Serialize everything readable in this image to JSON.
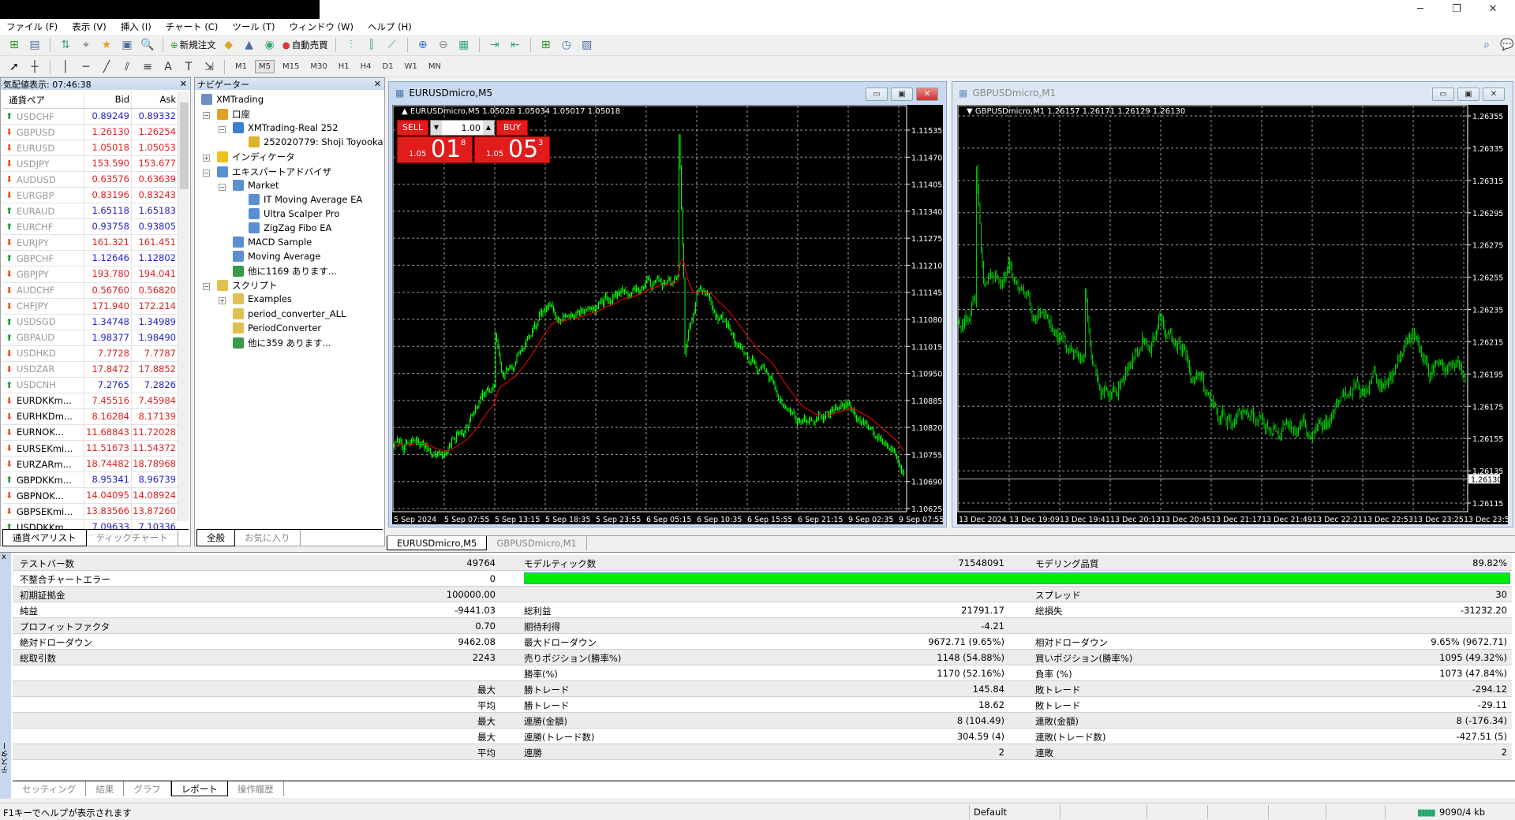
{
  "window": {
    "minimize": "─",
    "restore": "❐",
    "close": "✕"
  },
  "menu": [
    "ファイル (F)",
    "表示 (V)",
    "挿入 (I)",
    "チャート (C)",
    "ツール (T)",
    "ウィンドウ (W)",
    "ヘルプ (H)"
  ],
  "toolbar1": {
    "new_order": "新規注文",
    "auto_trading": "自動売買"
  },
  "toolbar2": {
    "timeframes": [
      "M1",
      "M5",
      "M15",
      "M30",
      "H1",
      "H4",
      "D1",
      "W1",
      "MN"
    ],
    "active_timeframe": "M5"
  },
  "market_watch": {
    "title": "気配値表示: 07:46:38",
    "columns": [
      "通貨ペア",
      "Bid",
      "Ask"
    ],
    "rows": [
      {
        "symbol": "USDCHF",
        "bid": "0.89249",
        "ask": "0.89332",
        "dir": "up",
        "dim": true
      },
      {
        "symbol": "GBPUSD",
        "bid": "1.26130",
        "ask": "1.26254",
        "dir": "down",
        "dim": true
      },
      {
        "symbol": "EURUSD",
        "bid": "1.05018",
        "ask": "1.05053",
        "dir": "down",
        "dim": true
      },
      {
        "symbol": "USDJPY",
        "bid": "153.590",
        "ask": "153.677",
        "dir": "down",
        "dim": true
      },
      {
        "symbol": "AUDUSD",
        "bid": "0.63576",
        "ask": "0.63639",
        "dir": "down",
        "dim": true
      },
      {
        "symbol": "EURGBP",
        "bid": "0.83196",
        "ask": "0.83243",
        "dir": "down",
        "dim": true
      },
      {
        "symbol": "EURAUD",
        "bid": "1.65118",
        "ask": "1.65183",
        "dir": "up",
        "dim": true
      },
      {
        "symbol": "EURCHF",
        "bid": "0.93758",
        "ask": "0.93805",
        "dir": "up",
        "dim": true
      },
      {
        "symbol": "EURJPY",
        "bid": "161.321",
        "ask": "161.451",
        "dir": "down",
        "dim": true
      },
      {
        "symbol": "GBPCHF",
        "bid": "1.12646",
        "ask": "1.12802",
        "dir": "up",
        "dim": true
      },
      {
        "symbol": "GBPJPY",
        "bid": "193.780",
        "ask": "194.041",
        "dir": "down",
        "dim": true
      },
      {
        "symbol": "AUDCHF",
        "bid": "0.56760",
        "ask": "0.56820",
        "dir": "down",
        "dim": true
      },
      {
        "symbol": "CHFJPY",
        "bid": "171.940",
        "ask": "172.214",
        "dir": "down",
        "dim": true
      },
      {
        "symbol": "USDSGD",
        "bid": "1.34748",
        "ask": "1.34989",
        "dir": "up",
        "dim": true
      },
      {
        "symbol": "GBPAUD",
        "bid": "1.98377",
        "ask": "1.98490",
        "dir": "up",
        "dim": true
      },
      {
        "symbol": "USDHKD",
        "bid": "7.7728",
        "ask": "7.7787",
        "dir": "down",
        "dim": true
      },
      {
        "symbol": "USDZAR",
        "bid": "17.8472",
        "ask": "17.8852",
        "dir": "down",
        "dim": true
      },
      {
        "symbol": "USDCNH",
        "bid": "7.2765",
        "ask": "7.2826",
        "dir": "up",
        "dim": true
      },
      {
        "symbol": "EURDKKm...",
        "bid": "7.45516",
        "ask": "7.45984",
        "dir": "down",
        "dim": false
      },
      {
        "symbol": "EURHKDm...",
        "bid": "8.16284",
        "ask": "8.17139",
        "dir": "down",
        "dim": false
      },
      {
        "symbol": "EURNOK...",
        "bid": "11.68843",
        "ask": "11.72028",
        "dir": "down",
        "dim": false
      },
      {
        "symbol": "EURSEKmi...",
        "bid": "11.51673",
        "ask": "11.54372",
        "dir": "down",
        "dim": false
      },
      {
        "symbol": "EURZARm...",
        "bid": "18.74482",
        "ask": "18.78968",
        "dir": "down",
        "dim": false
      },
      {
        "symbol": "GBPDKKm...",
        "bid": "8.95341",
        "ask": "8.96739",
        "dir": "up",
        "dim": false
      },
      {
        "symbol": "GBPNOK...",
        "bid": "14.04095",
        "ask": "14.08924",
        "dir": "down",
        "dim": false
      },
      {
        "symbol": "GBPSEKmi...",
        "bid": "13.83566",
        "ask": "13.87260",
        "dir": "down",
        "dim": false
      },
      {
        "symbol": "USDDKKm...",
        "bid": "7.09633",
        "ask": "7.10336",
        "dir": "up",
        "dim": false
      }
    ],
    "tabs": [
      "通貨ペアリスト",
      "ティックチャート"
    ]
  },
  "navigator": {
    "title": "ナビゲーター",
    "items": [
      {
        "label": "XMTrading",
        "level": 0,
        "icon": "terminal-icon"
      },
      {
        "label": "口座",
        "level": 1,
        "icon": "accounts-icon",
        "exp": "-"
      },
      {
        "label": "XMTrading-Real 252",
        "level": 2,
        "icon": "server-icon",
        "exp": "-"
      },
      {
        "label": "252020779: Shoji Toyooka",
        "level": 3,
        "icon": "user-icon"
      },
      {
        "label": "インディケータ",
        "level": 1,
        "icon": "indicator-icon",
        "exp": "+"
      },
      {
        "label": "エキスパートアドバイザ",
        "level": 1,
        "icon": "expert-icon",
        "exp": "-"
      },
      {
        "label": "Market",
        "level": 2,
        "icon": "expert-icon",
        "exp": "-"
      },
      {
        "label": "IT Moving Average EA",
        "level": 3,
        "icon": "expert-icon"
      },
      {
        "label": "Ultra Scalper Pro",
        "level": 3,
        "icon": "expert-icon"
      },
      {
        "label": "ZigZag Fibo EA",
        "level": 3,
        "icon": "expert-icon"
      },
      {
        "label": "MACD Sample",
        "level": 2,
        "icon": "expert-icon"
      },
      {
        "label": "Moving Average",
        "level": 2,
        "icon": "expert-icon"
      },
      {
        "label": "他に1169 あります...",
        "level": 2,
        "icon": "globe-icon"
      },
      {
        "label": "スクリプト",
        "level": 1,
        "icon": "script-icon",
        "exp": "-"
      },
      {
        "label": "Examples",
        "level": 2,
        "icon": "script-icon",
        "exp": "+"
      },
      {
        "label": "period_converter_ALL",
        "level": 2,
        "icon": "script-icon"
      },
      {
        "label": "PeriodConverter",
        "level": 2,
        "icon": "script-icon"
      },
      {
        "label": "他に359 あります...",
        "level": 2,
        "icon": "globe-icon"
      }
    ],
    "tabs": [
      "全般",
      "お気に入り"
    ]
  },
  "charts": [
    {
      "window_title": "EURUSDmicro,M5",
      "info": "EURUSDmicro,M5  1.05028 1.05034 1.05017 1.05018",
      "active": true,
      "one_click": {
        "sell": "SELL",
        "buy": "BUY",
        "lots": "1.00",
        "sell_small": "1.05",
        "sell_big": "01",
        "sell_pip": "8",
        "buy_small": "1.05",
        "buy_big": "05",
        "buy_pip": "3"
      },
      "chart_data": {
        "type": "bar",
        "price_ticks": [
          "1.11535",
          "1.11470",
          "1.11405",
          "1.11340",
          "1.11275",
          "1.11210",
          "1.11145",
          "1.11080",
          "1.11015",
          "1.10950",
          "1.10885",
          "1.10820",
          "1.10755",
          "1.10690",
          "1.10625"
        ],
        "time_ticks": [
          "5 Sep 2024",
          "5 Sep 07:55",
          "5 Sep 13:15",
          "5 Sep 18:35",
          "5 Sep 23:55",
          "6 Sep 05:15",
          "6 Sep 10:35",
          "6 Sep 15:55",
          "6 Sep 21:15",
          "9 Sep 02:35",
          "9 Sep 07:55"
        ],
        "ylim": [
          1.10625,
          1.11535
        ],
        "approx_path": [
          [
            "5 Sep 2024",
            1.1078
          ],
          [
            "5 Sep 07:55",
            1.1076
          ],
          [
            "5 Sep 13:15",
            1.1092
          ],
          [
            "5 Sep 18:35",
            1.1108
          ],
          [
            "5 Sep 23:55",
            1.1112
          ],
          [
            "6 Sep 05:15",
            1.1117
          ],
          [
            "6 Sep 10:35",
            1.1116
          ],
          [
            "6 Sep 15:55",
            1.11
          ],
          [
            "6 Sep 21:15",
            1.1084
          ],
          [
            "9 Sep 02:35",
            1.1087
          ],
          [
            "9 Sep 07:55",
            1.1076
          ]
        ],
        "grid": true,
        "bar_color": "#00ff00",
        "ma_color": "#ff0000"
      }
    },
    {
      "window_title": "GBPUSDmicro,M1",
      "info": "GBPUSDmicro,M1  1.26157 1.26171 1.26129 1.26130",
      "active": false,
      "current_price": "1.26130",
      "chart_data": {
        "type": "bar",
        "price_ticks": [
          "1.26355",
          "1.26335",
          "1.26315",
          "1.26295",
          "1.26275",
          "1.26255",
          "1.26235",
          "1.26215",
          "1.26195",
          "1.26175",
          "1.26155",
          "1.26135",
          "1.26115"
        ],
        "time_ticks": [
          "13 Dec 2024",
          "13 Dec 19:09",
          "13 Dec 19:41",
          "13 Dec 20:13",
          "13 Dec 20:45",
          "13 Dec 21:17",
          "13 Dec 21:49",
          "13 Dec 22:21",
          "13 Dec 22:53",
          "13 Dec 23:25",
          "13 Dec 23:57"
        ],
        "ylim": [
          1.26115,
          1.26355
        ],
        "approx_path": [
          [
            "13 Dec 2024",
            1.2623
          ],
          [
            "13 Dec 19:09",
            1.2626
          ],
          [
            "13 Dec 19:41",
            1.2621
          ],
          [
            "13 Dec 20:13",
            1.2619
          ],
          [
            "13 Dec 20:45",
            1.2623
          ],
          [
            "13 Dec 21:17",
            1.2617
          ],
          [
            "13 Dec 21:49",
            1.2617
          ],
          [
            "13 Dec 22:21",
            1.2616
          ],
          [
            "13 Dec 22:53",
            1.2618
          ],
          [
            "13 Dec 23:25",
            1.2621
          ],
          [
            "13 Dec 23:57",
            1.2619
          ]
        ],
        "grid": true,
        "bar_color": "#00c800"
      }
    }
  ],
  "chart_tabs": [
    "EURUSDmicro,M5",
    "GBPUSDmicro,M1"
  ],
  "tester": {
    "side_label": "テスター",
    "close": "x",
    "rows": [
      [
        "テストバー数",
        "49764",
        "モデルティック数",
        "71548091",
        "モデリング品質",
        "89.82%"
      ],
      [
        "不整合チャートエラー",
        "0",
        "",
        "",
        "",
        ""
      ],
      [
        "初期証拠金",
        "100000.00",
        "",
        "",
        "スプレッド",
        "30"
      ],
      [
        "純益",
        "-9441.03",
        "総利益",
        "21791.17",
        "総損失",
        "-31232.20"
      ],
      [
        "プロフィットファクタ",
        "0.70",
        "期待利得",
        "-4.21",
        "",
        ""
      ],
      [
        "絶対ドローダウン",
        "9462.08",
        "最大ドローダウン",
        "9672.71 (9.65%)",
        "相対ドローダウン",
        "9.65% (9672.71)"
      ],
      [
        "総取引数",
        "2243",
        "売りポジション(勝率%)",
        "1148 (54.88%)",
        "買いポジション(勝率%)",
        "1095 (49.32%)"
      ],
      [
        "",
        "",
        "勝率(%)",
        "1170 (52.16%)",
        "負率 (%)",
        "1073 (47.84%)"
      ],
      [
        "",
        "最大",
        "勝トレード",
        "145.84",
        "敗トレード",
        "-294.12"
      ],
      [
        "",
        "平均",
        "勝トレード",
        "18.62",
        "敗トレード",
        "-29.11"
      ],
      [
        "",
        "最大",
        "連勝(金額)",
        "8 (104.49)",
        "連敗(金額)",
        "8 (-176.34)"
      ],
      [
        "",
        "最大",
        "連勝(トレード数)",
        "304.59 (4)",
        "連敗(トレード数)",
        "-427.51 (5)"
      ],
      [
        "",
        "平均",
        "連勝",
        "2",
        "連敗",
        "2"
      ]
    ],
    "modeling_quality_fill": 1.0,
    "quality_color": "#00ee00",
    "tabs": [
      "セッティング",
      "結果",
      "グラフ",
      "レポート",
      "操作履歴"
    ],
    "active_tab": "レポート"
  },
  "status": {
    "help": "F1キーでヘルプが表示されます",
    "profile": "Default",
    "traffic": "9090/4 kb"
  }
}
